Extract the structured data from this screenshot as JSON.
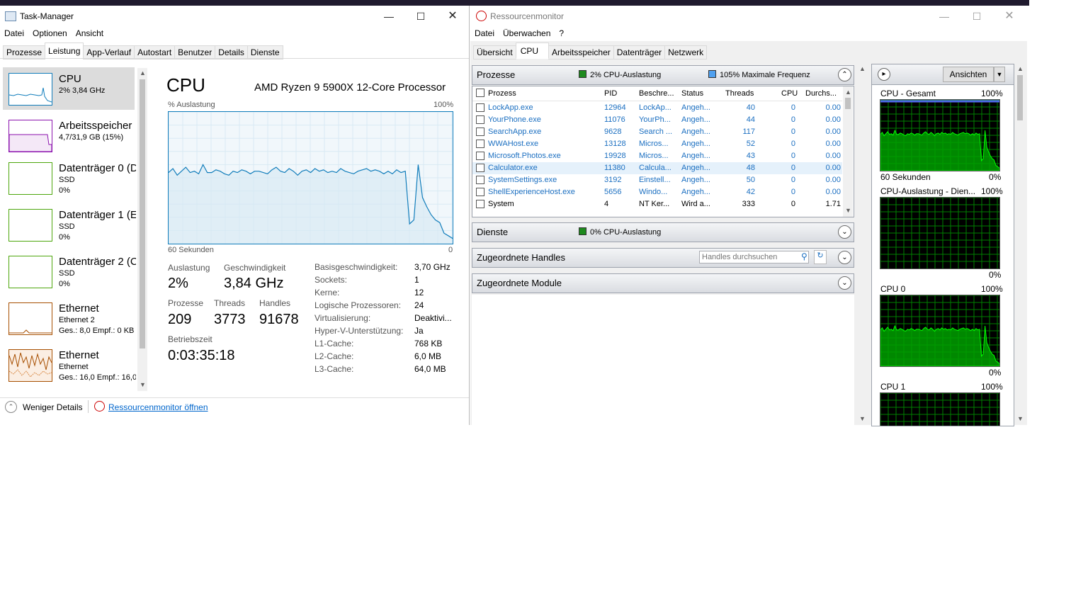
{
  "task_manager": {
    "title": "Task-Manager",
    "menu": [
      "Datei",
      "Optionen",
      "Ansicht"
    ],
    "tabs": [
      "Prozesse",
      "Leistung",
      "App-Verlauf",
      "Autostart",
      "Benutzer",
      "Details",
      "Dienste"
    ],
    "sidebar": [
      {
        "name": "CPU",
        "line2": "2% 3,84 GHz",
        "line3": ""
      },
      {
        "name": "Arbeitsspeicher",
        "line2": "4,7/31,9 GB (15%)",
        "line3": ""
      },
      {
        "name": "Datenträger 0 (D",
        "line2": "SSD",
        "line3": "0%"
      },
      {
        "name": "Datenträger 1 (E",
        "line2": "SSD",
        "line3": "0%"
      },
      {
        "name": "Datenträger 2 (C",
        "line2": "SSD",
        "line3": "0%"
      },
      {
        "name": "Ethernet",
        "line2": "Ethernet 2",
        "line3": "Ges.: 8,0 Empf.: 0 KB"
      },
      {
        "name": "Ethernet",
        "line2": "Ethernet",
        "line3": "Ges.: 16,0 Empf.: 16,0"
      }
    ],
    "cpu": {
      "heading": "CPU",
      "model": "AMD Ryzen 9 5900X 12-Core Processor",
      "graph_label": "% Auslastung",
      "graph_max": "100%",
      "graph_time": "60 Sekunden",
      "graph_min": "0",
      "usage_series": [
        54,
        57,
        52,
        55,
        58,
        54,
        55,
        53,
        60,
        54,
        54,
        56,
        55,
        53,
        52,
        55,
        54,
        56,
        55,
        53,
        55,
        55,
        54,
        53,
        56,
        58,
        55,
        54,
        57,
        55,
        52,
        55,
        56,
        54,
        57,
        55,
        56,
        54,
        55,
        54,
        57,
        55,
        54,
        53,
        55,
        56,
        57,
        55,
        56,
        55,
        53,
        55,
        53,
        56,
        54,
        55,
        15,
        18,
        60,
        35,
        28,
        22,
        18,
        16,
        8,
        6,
        4
      ],
      "stats": {
        "auslastung_label": "Auslastung",
        "auslastung": "2%",
        "geschw_label": "Geschwindigkeit",
        "geschw": "3,84 GHz",
        "prozesse_label": "Prozesse",
        "prozesse": "209",
        "threads_label": "Threads",
        "threads": "3773",
        "handles_label": "Handles",
        "handles": "91678",
        "betrieb_label": "Betriebszeit",
        "betrieb": "0:03:35:18"
      },
      "details": [
        {
          "k": "Basisgeschwindigkeit:",
          "v": "3,70 GHz"
        },
        {
          "k": "Sockets:",
          "v": "1"
        },
        {
          "k": "Kerne:",
          "v": "12"
        },
        {
          "k": "Logische Prozessoren:",
          "v": "24"
        },
        {
          "k": "Virtualisierung:",
          "v": "Deaktivi..."
        },
        {
          "k": "Hyper-V-Unterstützung:",
          "v": "Ja"
        },
        {
          "k": "L1-Cache:",
          "v": "768 KB"
        },
        {
          "k": "L2-Cache:",
          "v": "6,0 MB"
        },
        {
          "k": "L3-Cache:",
          "v": "64,0 MB"
        }
      ]
    },
    "footer": {
      "fewer": "Weniger Details",
      "open_rm": "Ressourcenmonitor öffnen"
    }
  },
  "resmon": {
    "title": "Ressourcenmonitor",
    "menu": [
      "Datei",
      "Überwachen",
      "?"
    ],
    "tabs": [
      "Übersicht",
      "CPU",
      "Arbeitsspeicher",
      "Datenträger",
      "Netzwerk"
    ],
    "processes": {
      "title": "Prozesse",
      "usage": "2% CPU-Auslastung",
      "freq": "105% Maximale Frequenz",
      "columns": [
        "Prozess",
        "PID",
        "Beschre...",
        "Status",
        "Threads",
        "CPU",
        "Durchs..."
      ],
      "rows": [
        [
          "LockApp.exe",
          "12964",
          "LockAp...",
          "Angeh...",
          "40",
          "0",
          "0.00"
        ],
        [
          "YourPhone.exe",
          "11076",
          "YourPh...",
          "Angeh...",
          "44",
          "0",
          "0.00"
        ],
        [
          "SearchApp.exe",
          "9628",
          "Search ...",
          "Angeh...",
          "117",
          "0",
          "0.00"
        ],
        [
          "WWAHost.exe",
          "13128",
          "Micros...",
          "Angeh...",
          "52",
          "0",
          "0.00"
        ],
        [
          "Microsoft.Photos.exe",
          "19928",
          "Micros...",
          "Angeh...",
          "43",
          "0",
          "0.00"
        ],
        [
          "Calculator.exe",
          "11380",
          "Calcula...",
          "Angeh...",
          "48",
          "0",
          "0.00"
        ],
        [
          "SystemSettings.exe",
          "3192",
          "Einstell...",
          "Angeh...",
          "50",
          "0",
          "0.00"
        ],
        [
          "ShellExperienceHost.exe",
          "5656",
          "Windo...",
          "Angeh...",
          "42",
          "0",
          "0.00"
        ],
        [
          "System",
          "4",
          "NT Ker...",
          "Wird a...",
          "333",
          "0",
          "1.71"
        ]
      ]
    },
    "services": {
      "title": "Dienste",
      "usage": "0% CPU-Auslastung"
    },
    "handles": {
      "title": "Zugeordnete Handles",
      "search_placeholder": "Handles durchsuchen"
    },
    "modules": {
      "title": "Zugeordnete Module"
    },
    "panel": {
      "views_button": "Ansichten",
      "graphs": [
        {
          "title": "CPU - Gesamt",
          "max": "100%",
          "bottom_left": "60 Sekunden",
          "bottom_right": "0%"
        },
        {
          "title": "CPU-Auslastung - Dien...",
          "max": "100%",
          "bottom_left": "",
          "bottom_right": "0%"
        },
        {
          "title": "CPU 0",
          "max": "100%",
          "bottom_left": "",
          "bottom_right": "0%"
        },
        {
          "title": "CPU 1",
          "max": "100%",
          "bottom_left": "",
          "bottom_right": ""
        }
      ]
    }
  },
  "colors": {
    "cpu_line": "#117dbb",
    "mem": "#8b12ae",
    "disk": "#4da60c",
    "net": "#a74f01",
    "rm_green": "#00c000"
  }
}
